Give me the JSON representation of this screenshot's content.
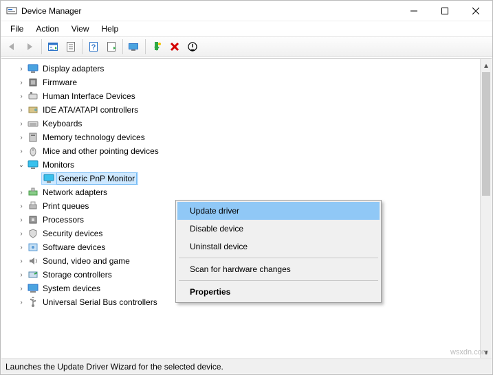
{
  "window": {
    "title": "Device Manager"
  },
  "menu": {
    "file": "File",
    "action": "Action",
    "view": "View",
    "help": "Help"
  },
  "tree": {
    "items": [
      {
        "label": "Display adapters",
        "icon": "display",
        "expanded": false,
        "indent": 0
      },
      {
        "label": "Firmware",
        "icon": "chip",
        "expanded": false,
        "indent": 0
      },
      {
        "label": "Human Interface Devices",
        "icon": "hid",
        "expanded": false,
        "indent": 0
      },
      {
        "label": "IDE ATA/ATAPI controllers",
        "icon": "ide",
        "expanded": false,
        "indent": 0
      },
      {
        "label": "Keyboards",
        "icon": "keyboard",
        "expanded": false,
        "indent": 0
      },
      {
        "label": "Memory technology devices",
        "icon": "memory",
        "expanded": false,
        "indent": 0
      },
      {
        "label": "Mice and other pointing devices",
        "icon": "mouse",
        "expanded": false,
        "indent": 0
      },
      {
        "label": "Monitors",
        "icon": "monitor",
        "expanded": true,
        "indent": 0
      },
      {
        "label": "Generic PnP Monitor",
        "icon": "monitor",
        "expanded": null,
        "indent": 1,
        "selected": true
      },
      {
        "label": "Network adapters",
        "icon": "network",
        "expanded": false,
        "indent": 0
      },
      {
        "label": "Print queues",
        "icon": "printer",
        "expanded": false,
        "indent": 0
      },
      {
        "label": "Processors",
        "icon": "cpu",
        "expanded": false,
        "indent": 0
      },
      {
        "label": "Security devices",
        "icon": "security",
        "expanded": false,
        "indent": 0
      },
      {
        "label": "Software devices",
        "icon": "software",
        "expanded": false,
        "indent": 0
      },
      {
        "label": "Sound, video and game",
        "icon": "sound",
        "expanded": false,
        "indent": 0,
        "truncated": true
      },
      {
        "label": "Storage controllers",
        "icon": "storage",
        "expanded": false,
        "indent": 0
      },
      {
        "label": "System devices",
        "icon": "system",
        "expanded": false,
        "indent": 0
      },
      {
        "label": "Universal Serial Bus controllers",
        "icon": "usb",
        "expanded": false,
        "indent": 0
      }
    ]
  },
  "context_menu": {
    "update": "Update driver",
    "disable": "Disable device",
    "uninstall": "Uninstall device",
    "scan": "Scan for hardware changes",
    "props": "Properties"
  },
  "status": {
    "text": "Launches the Update Driver Wizard for the selected device."
  },
  "watermark": "wsxdn.com"
}
